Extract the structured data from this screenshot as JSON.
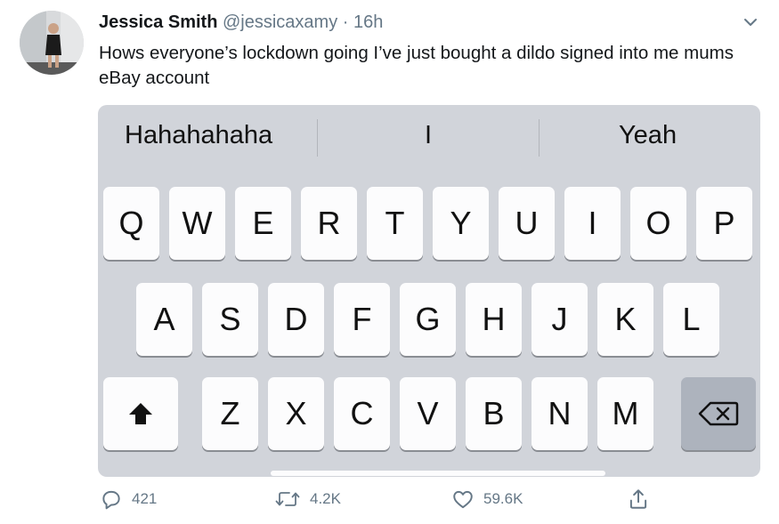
{
  "tweet": {
    "author_name": "Jessica Smith",
    "handle": "@jessicaxamy",
    "separator": "·",
    "time": "16h",
    "text": "Hows everyone’s lockdown going I’ve just bought a dildo signed into me mums eBay account"
  },
  "keyboard": {
    "suggestions": [
      "Hahahahaha",
      "I",
      "Yeah"
    ],
    "row1": [
      "Q",
      "W",
      "E",
      "R",
      "T",
      "Y",
      "U",
      "I",
      "O",
      "P"
    ],
    "row2": [
      "A",
      "S",
      "D",
      "F",
      "G",
      "H",
      "J",
      "K",
      "L"
    ],
    "row3": [
      "Z",
      "X",
      "C",
      "V",
      "B",
      "N",
      "M"
    ]
  },
  "actions": {
    "replies": "421",
    "retweets": "4.2K",
    "likes": "59.6K"
  },
  "icons": [
    "caret-down-icon",
    "shift-icon",
    "delete-icon",
    "reply-icon",
    "retweet-icon",
    "like-icon",
    "share-icon"
  ],
  "colors": {
    "muted": "#657786",
    "keyboard_bg": "#d1d4da",
    "key_bg": "#fcfcfd",
    "special_key_bg": "#adb3bd"
  }
}
